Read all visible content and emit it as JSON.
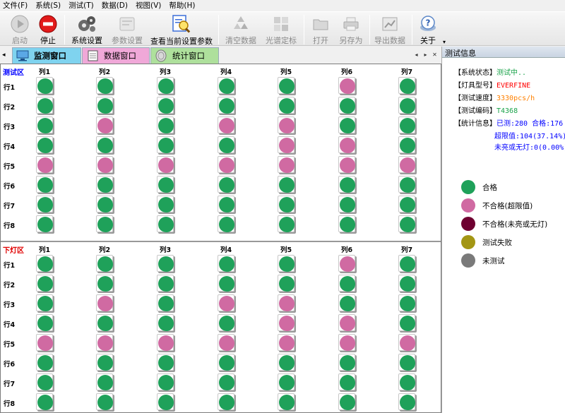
{
  "menu": [
    "文件(F)",
    "系统(S)",
    "测试(T)",
    "数据(D)",
    "视图(V)",
    "帮助(H)"
  ],
  "toolbar": [
    {
      "key": "start",
      "label": "启动",
      "icon": "play-icon",
      "disabled": true
    },
    {
      "key": "stop",
      "label": "停止",
      "icon": "stop-icon",
      "disabled": false
    },
    {
      "key": "system_settings",
      "label": "系统设置",
      "icon": "gears-icon",
      "disabled": false
    },
    {
      "key": "param_settings",
      "label": "参数设置",
      "icon": "params-icon",
      "disabled": true
    },
    {
      "key": "view_params",
      "label": "查看当前设置参数",
      "icon": "magnifier-document-icon",
      "disabled": false
    },
    {
      "key": "clear_data",
      "label": "清空数据",
      "icon": "recycle-icon",
      "disabled": true
    },
    {
      "key": "spectrum_calib",
      "label": "光谱定标",
      "icon": "windows-icon",
      "disabled": true
    },
    {
      "key": "open",
      "label": "打开",
      "icon": "folder-icon",
      "disabled": true
    },
    {
      "key": "save_as",
      "label": "另存为",
      "icon": "printer-icon",
      "disabled": true
    },
    {
      "key": "export_data",
      "label": "导出数据",
      "icon": "chart-export-icon",
      "disabled": true
    },
    {
      "key": "about",
      "label": "关于",
      "icon": "help-icon",
      "disabled": false
    }
  ],
  "tabs": [
    {
      "label": "监测窗口",
      "icon": "monitor-icon",
      "active": true
    },
    {
      "label": "数据窗口",
      "icon": "notebook-icon",
      "active": false
    },
    {
      "label": "统计窗口",
      "icon": "coin-icon",
      "active": false
    }
  ],
  "grid": {
    "columns": [
      "列1",
      "列2",
      "列3",
      "列4",
      "列5",
      "列6",
      "列7"
    ],
    "rows": [
      "行1",
      "行2",
      "行3",
      "行4",
      "行5",
      "行6",
      "行7",
      "行8"
    ],
    "zones": [
      {
        "label": "测试区",
        "status": [
          [
            "pass",
            "pass",
            "pass",
            "pass",
            "pass",
            "fail",
            "pass"
          ],
          [
            "pass",
            "pass",
            "pass",
            "pass",
            "pass",
            "pass",
            "pass"
          ],
          [
            "pass",
            "fail",
            "pass",
            "fail",
            "fail",
            "pass",
            "pass"
          ],
          [
            "pass",
            "pass",
            "pass",
            "pass",
            "fail",
            "fail",
            "pass"
          ],
          [
            "fail",
            "fail",
            "fail",
            "fail",
            "fail",
            "fail",
            "fail"
          ],
          [
            "pass",
            "pass",
            "pass",
            "pass",
            "pass",
            "pass",
            "pass"
          ],
          [
            "pass",
            "pass",
            "pass",
            "pass",
            "pass",
            "pass",
            "pass"
          ],
          [
            "pass",
            "pass",
            "pass",
            "pass",
            "pass",
            "pass",
            "pass"
          ]
        ]
      },
      {
        "label": "下灯区",
        "status": [
          [
            "pass",
            "pass",
            "pass",
            "pass",
            "pass",
            "fail",
            "pass"
          ],
          [
            "pass",
            "pass",
            "pass",
            "pass",
            "pass",
            "pass",
            "pass"
          ],
          [
            "pass",
            "fail",
            "pass",
            "fail",
            "fail",
            "pass",
            "pass"
          ],
          [
            "pass",
            "pass",
            "pass",
            "pass",
            "fail",
            "fail",
            "pass"
          ],
          [
            "fail",
            "fail",
            "fail",
            "fail",
            "fail",
            "fail",
            "fail"
          ],
          [
            "pass",
            "pass",
            "pass",
            "pass",
            "pass",
            "pass",
            "pass"
          ],
          [
            "pass",
            "pass",
            "pass",
            "pass",
            "pass",
            "pass",
            "pass"
          ],
          [
            "pass",
            "pass",
            "pass",
            "pass",
            "pass",
            "pass",
            "pass"
          ]
        ]
      }
    ]
  },
  "info": {
    "title": "测试信息",
    "system_status_label": "【系统状态】",
    "system_status": "测试中..",
    "lamp_model_label": "【灯具型号】",
    "lamp_model": "EVERFINE",
    "speed_label": "【测试速度】",
    "speed": "3330pcs/h",
    "code_label": "【测试编码】",
    "code": "T4368",
    "stats_label": "【统计信息】",
    "stats_line1": "已测:280  合格:176",
    "stats_line2": "超限值:104(37.14%)",
    "stats_line3": "未亮或无灯:0(0.00%)"
  },
  "legend": [
    {
      "label": "合格",
      "color": "#1fa15a"
    },
    {
      "label": "不合格(超限值)",
      "color": "#d06aa2"
    },
    {
      "label": "不合格(未亮或无灯)",
      "color": "#6e0030"
    },
    {
      "label": "测试失败",
      "color": "#a39614"
    },
    {
      "label": "未测试",
      "color": "#7a7a7a"
    }
  ],
  "colors": {
    "pass": "#1fa15a",
    "fail": "#d06aa2",
    "info_black": "#000000",
    "status_green": "#1aa34a",
    "model_red": "#ff0000",
    "speed_orange": "#ff8000",
    "code_green": "#1aa34a",
    "stats_blue": "#0000ff"
  }
}
